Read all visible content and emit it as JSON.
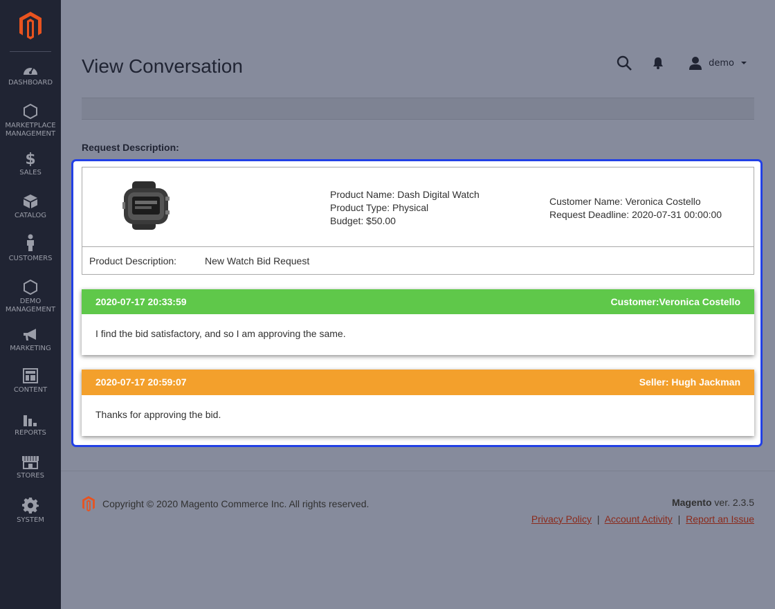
{
  "sidebar": {
    "items": [
      {
        "label": "DASHBOARD",
        "icon": "dashboard-icon"
      },
      {
        "label": "MARKETPLACE MANAGEMENT",
        "icon": "hexagon-icon"
      },
      {
        "label": "SALES",
        "icon": "dollar-icon"
      },
      {
        "label": "CATALOG",
        "icon": "box-icon"
      },
      {
        "label": "CUSTOMERS",
        "icon": "person-icon"
      },
      {
        "label": "DEMO MANAGEMENT",
        "icon": "hexagon-icon"
      },
      {
        "label": "MARKETING",
        "icon": "megaphone-icon"
      },
      {
        "label": "CONTENT",
        "icon": "layout-icon"
      },
      {
        "label": "REPORTS",
        "icon": "bar-chart-icon"
      },
      {
        "label": "STORES",
        "icon": "store-icon"
      },
      {
        "label": "SYSTEM",
        "icon": "gear-icon"
      }
    ]
  },
  "header": {
    "title": "View Conversation",
    "user": "demo"
  },
  "request": {
    "label": "Request Description:",
    "product_name": "Product Name: Dash Digital Watch",
    "product_type": "Product Type: Physical",
    "budget": "Budget: $50.00",
    "customer_name": "Customer Name: Veronica Costello",
    "deadline": "Request Deadline: 2020-07-31 00:00:00",
    "description_label": "Product Description:",
    "description_value": "New Watch Bid Request"
  },
  "messages": [
    {
      "timestamp": "2020-07-17 20:33:59",
      "author": "Customer:Veronica Costello",
      "text": "I find the bid satisfactory, and so I am approving the same.",
      "color": "#5fc84a"
    },
    {
      "timestamp": "2020-07-17 20:59:07",
      "author": "Seller: Hugh Jackman",
      "text": "Thanks for approving the bid.",
      "color": "#f3a02c"
    }
  ],
  "footer": {
    "copyright": "Copyright © 2020 Magento Commerce Inc. All rights reserved.",
    "brand": "Magento",
    "version": " ver. 2.3.5",
    "links": [
      "Privacy Policy",
      "Account Activity",
      "Report an Issue"
    ],
    "separator": "|"
  },
  "colors": {
    "sidebar_bg": "#202433",
    "highlight": "#2240e6",
    "link": "#8a2a1b"
  }
}
